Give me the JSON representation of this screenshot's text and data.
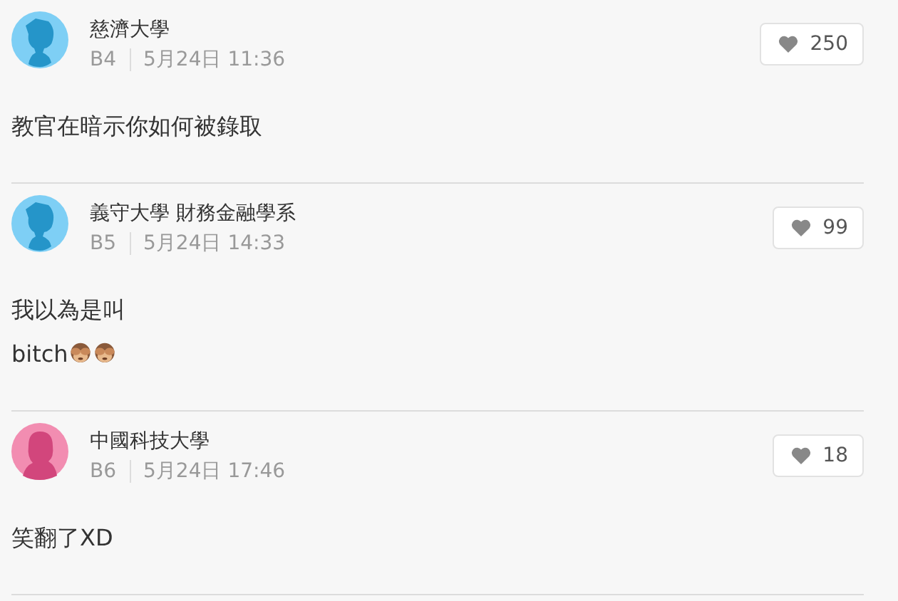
{
  "comments": [
    {
      "avatar": {
        "kind": "male"
      },
      "school": "慈濟大學",
      "floor": "B4",
      "time": "5月24日 11:36",
      "likes": "250",
      "lines": [
        [
          {
            "kind": "text",
            "text": "教官在暗示你如何被錄取"
          }
        ]
      ]
    },
    {
      "avatar": {
        "kind": "male"
      },
      "school": "義守大學 財務金融學系",
      "floor": "B5",
      "time": "5月24日 14:33",
      "likes": "99",
      "lines": [
        [
          {
            "kind": "text",
            "text": "我以為是叫"
          }
        ],
        [
          {
            "kind": "text",
            "text": "bitch"
          },
          {
            "kind": "emoji"
          },
          {
            "kind": "emoji"
          }
        ]
      ]
    },
    {
      "avatar": {
        "kind": "female"
      },
      "school": "中國科技大學",
      "floor": "B6",
      "time": "5月24日 17:46",
      "likes": "18",
      "lines": [
        [
          {
            "kind": "text",
            "text": "笑翻了XD"
          }
        ]
      ]
    }
  ]
}
